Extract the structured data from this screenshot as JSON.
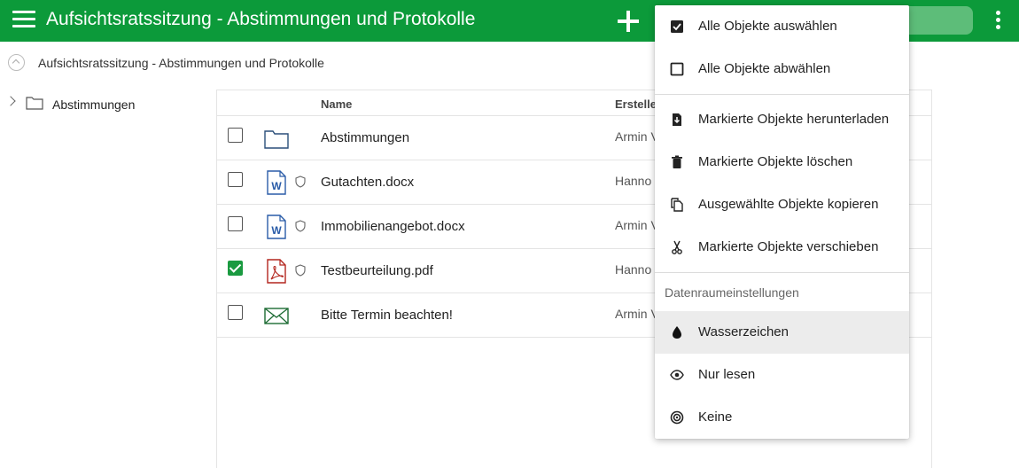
{
  "app": {
    "title": "Aufsichtsratssitzung - Abstimmungen und Protokolle",
    "menu_icon": "hamburger-icon",
    "add_icon": "plus-icon",
    "more_icon": "kebab-icon",
    "accent_color": "#0c9a3a"
  },
  "breadcrumb": {
    "up_icon": "chevron-up-circle-icon",
    "text": "Aufsichtsratssitzung - Abstimmungen und Protokolle"
  },
  "tree": {
    "items": [
      {
        "label": "Abstimmungen",
        "icon": "folder-icon"
      }
    ]
  },
  "list": {
    "columns": {
      "name": "Name",
      "creator": "Ersteller"
    },
    "rows": [
      {
        "name": "Abstimmungen",
        "creator": "Armin V",
        "type": "folder",
        "checked": false,
        "protected": false
      },
      {
        "name": "Gutachten.docx",
        "creator": "Hanno",
        "type": "word",
        "checked": false,
        "protected": true
      },
      {
        "name": "Immobilienangebot.docx",
        "creator": "Armin V",
        "type": "word",
        "checked": false,
        "protected": true
      },
      {
        "name": "Testbeurteilung.pdf",
        "creator": "Hanno",
        "type": "pdf",
        "checked": true,
        "protected": true
      },
      {
        "name": "Bitte Termin beachten!",
        "creator": "Armin V",
        "type": "email",
        "checked": false,
        "protected": false
      }
    ]
  },
  "menu": {
    "select_all": "Alle Objekte auswählen",
    "deselect_all": "Alle Objekte abwählen",
    "download": "Markierte Objekte herunterladen",
    "delete": "Markierte Objekte löschen",
    "copy": "Ausgewählte Objekte kopieren",
    "move": "Markierte Objekte verschieben",
    "section_title": "Datenraumeinstellungen",
    "watermark": "Wasserzeichen",
    "readonly": "Nur lesen",
    "none": "Keine"
  }
}
